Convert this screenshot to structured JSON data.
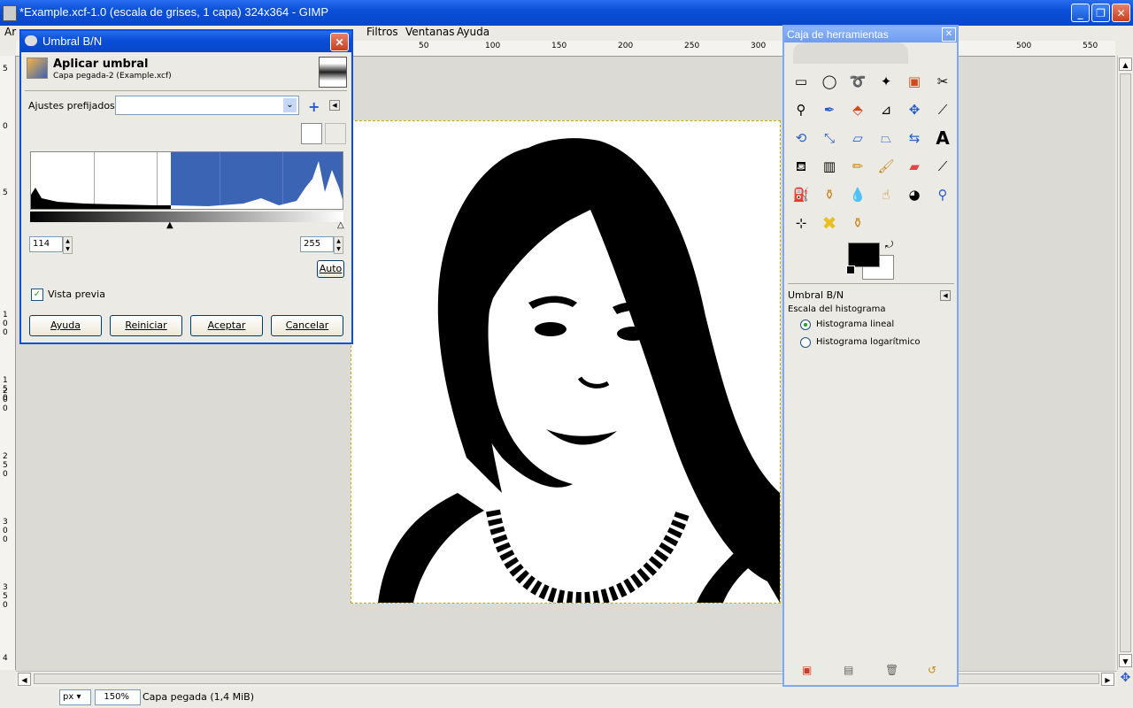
{
  "window": {
    "title": "*Example.xcf-1.0 (escala de grises, 1 capa) 324x364 - GIMP",
    "controls": {
      "minimize": "_",
      "maximize": "❐",
      "close": "✕"
    }
  },
  "menubar": {
    "items": [
      "Ar",
      "Filtros",
      "Ventanas",
      "Ayuda"
    ]
  },
  "ruler": {
    "h_ticks": [
      "50",
      "100",
      "150",
      "200",
      "250",
      "300",
      "500",
      "550"
    ],
    "v_ticks": [
      "5",
      "0",
      "5",
      "1 0 0",
      "1 5 0",
      "2 0 0",
      "2 5 0",
      "3 0 0",
      "3 5 0",
      "4"
    ]
  },
  "statusbar": {
    "unit": "px",
    "zoom": "150%",
    "message": "Capa pegada (1,4 MiB)"
  },
  "dialog": {
    "title": "Umbral B/N",
    "header_title": "Aplicar umbral",
    "header_sub": "Capa pegada-2 (Example.xcf)",
    "presets_label": "Ajustes prefijados:",
    "presets_value": "",
    "low": "114",
    "high": "255",
    "auto_label": "Auto",
    "preview_label": "Vista previa",
    "preview_checked": true,
    "buttons": {
      "help": "Ayuda",
      "reset": "Reiniciar",
      "ok": "Aceptar",
      "cancel": "Cancelar"
    }
  },
  "toolbox": {
    "title": "Caja de herramientas",
    "options_title": "Umbral B/N",
    "scale_label": "Escala del histograma",
    "linear_label": "Histograma lineal",
    "log_label": "Histograma logarítmico",
    "fg_color": "#000000",
    "bg_color": "#ffffff"
  },
  "colors": {
    "selection": "#3c64b4",
    "titlebar": "#0a50d8"
  }
}
